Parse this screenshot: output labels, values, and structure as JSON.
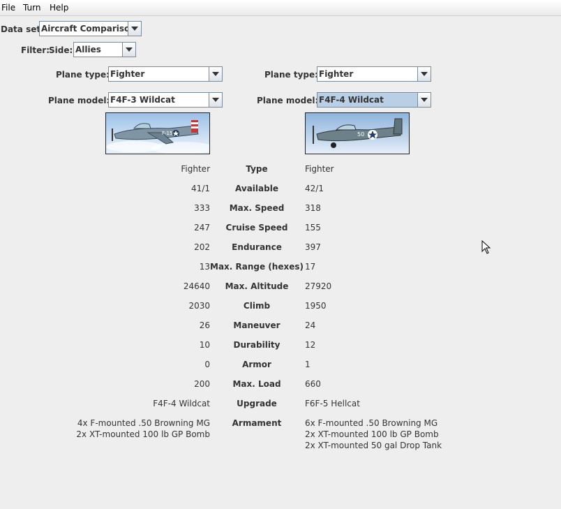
{
  "menu": [
    "File",
    "Turn",
    "Help"
  ],
  "dataset": {
    "label": "Data set:",
    "value": "Aircraft Comparison"
  },
  "filter": {
    "label": "Filter:",
    "side_label": "Side:",
    "side_value": "Allies"
  },
  "left": {
    "type_label": "Plane type:",
    "type_value": "Fighter",
    "model_label": "Plane model:",
    "model_value": "F4F-3 Wildcat",
    "image_text": "F-15"
  },
  "right": {
    "type_label": "Plane type:",
    "type_value": "Fighter",
    "model_label": "Plane model:",
    "model_value": "F4F-4 Wildcat",
    "image_text": "50"
  },
  "stats": [
    {
      "label": "Type",
      "left": "Fighter",
      "right": "Fighter"
    },
    {
      "label": "Available",
      "left": "41/1",
      "right": "42/1"
    },
    {
      "label": "Max. Speed",
      "left": "333",
      "right": "318"
    },
    {
      "label": "Cruise Speed",
      "left": "247",
      "right": "155"
    },
    {
      "label": "Endurance",
      "left": "202",
      "right": "397"
    },
    {
      "label": "Max. Range (hexes)",
      "left": "13",
      "right": "17"
    },
    {
      "label": "Max. Altitude",
      "left": "24640",
      "right": "27920"
    },
    {
      "label": "Climb",
      "left": "2030",
      "right": "1950"
    },
    {
      "label": "Maneuver",
      "left": "26",
      "right": "24"
    },
    {
      "label": "Durability",
      "left": "10",
      "right": "12"
    },
    {
      "label": "Armor",
      "left": "0",
      "right": "1"
    },
    {
      "label": "Max. Load",
      "left": "200",
      "right": "660"
    },
    {
      "label": "Upgrade",
      "left": "F4F-4 Wildcat",
      "right": "F6F-5 Hellcat"
    }
  ],
  "armament": {
    "label": "Armament",
    "left": [
      "4x F-mounted .50 Browning MG",
      "2x XT-mounted 100 lb GP Bomb"
    ],
    "right": [
      "6x F-mounted .50 Browning MG",
      "2x XT-mounted 100 lb GP Bomb",
      "2x XT-mounted 50 gal Drop Tank"
    ]
  },
  "colors": {
    "background": "#eeeeee",
    "selected_combo": "#b8cfe5"
  }
}
